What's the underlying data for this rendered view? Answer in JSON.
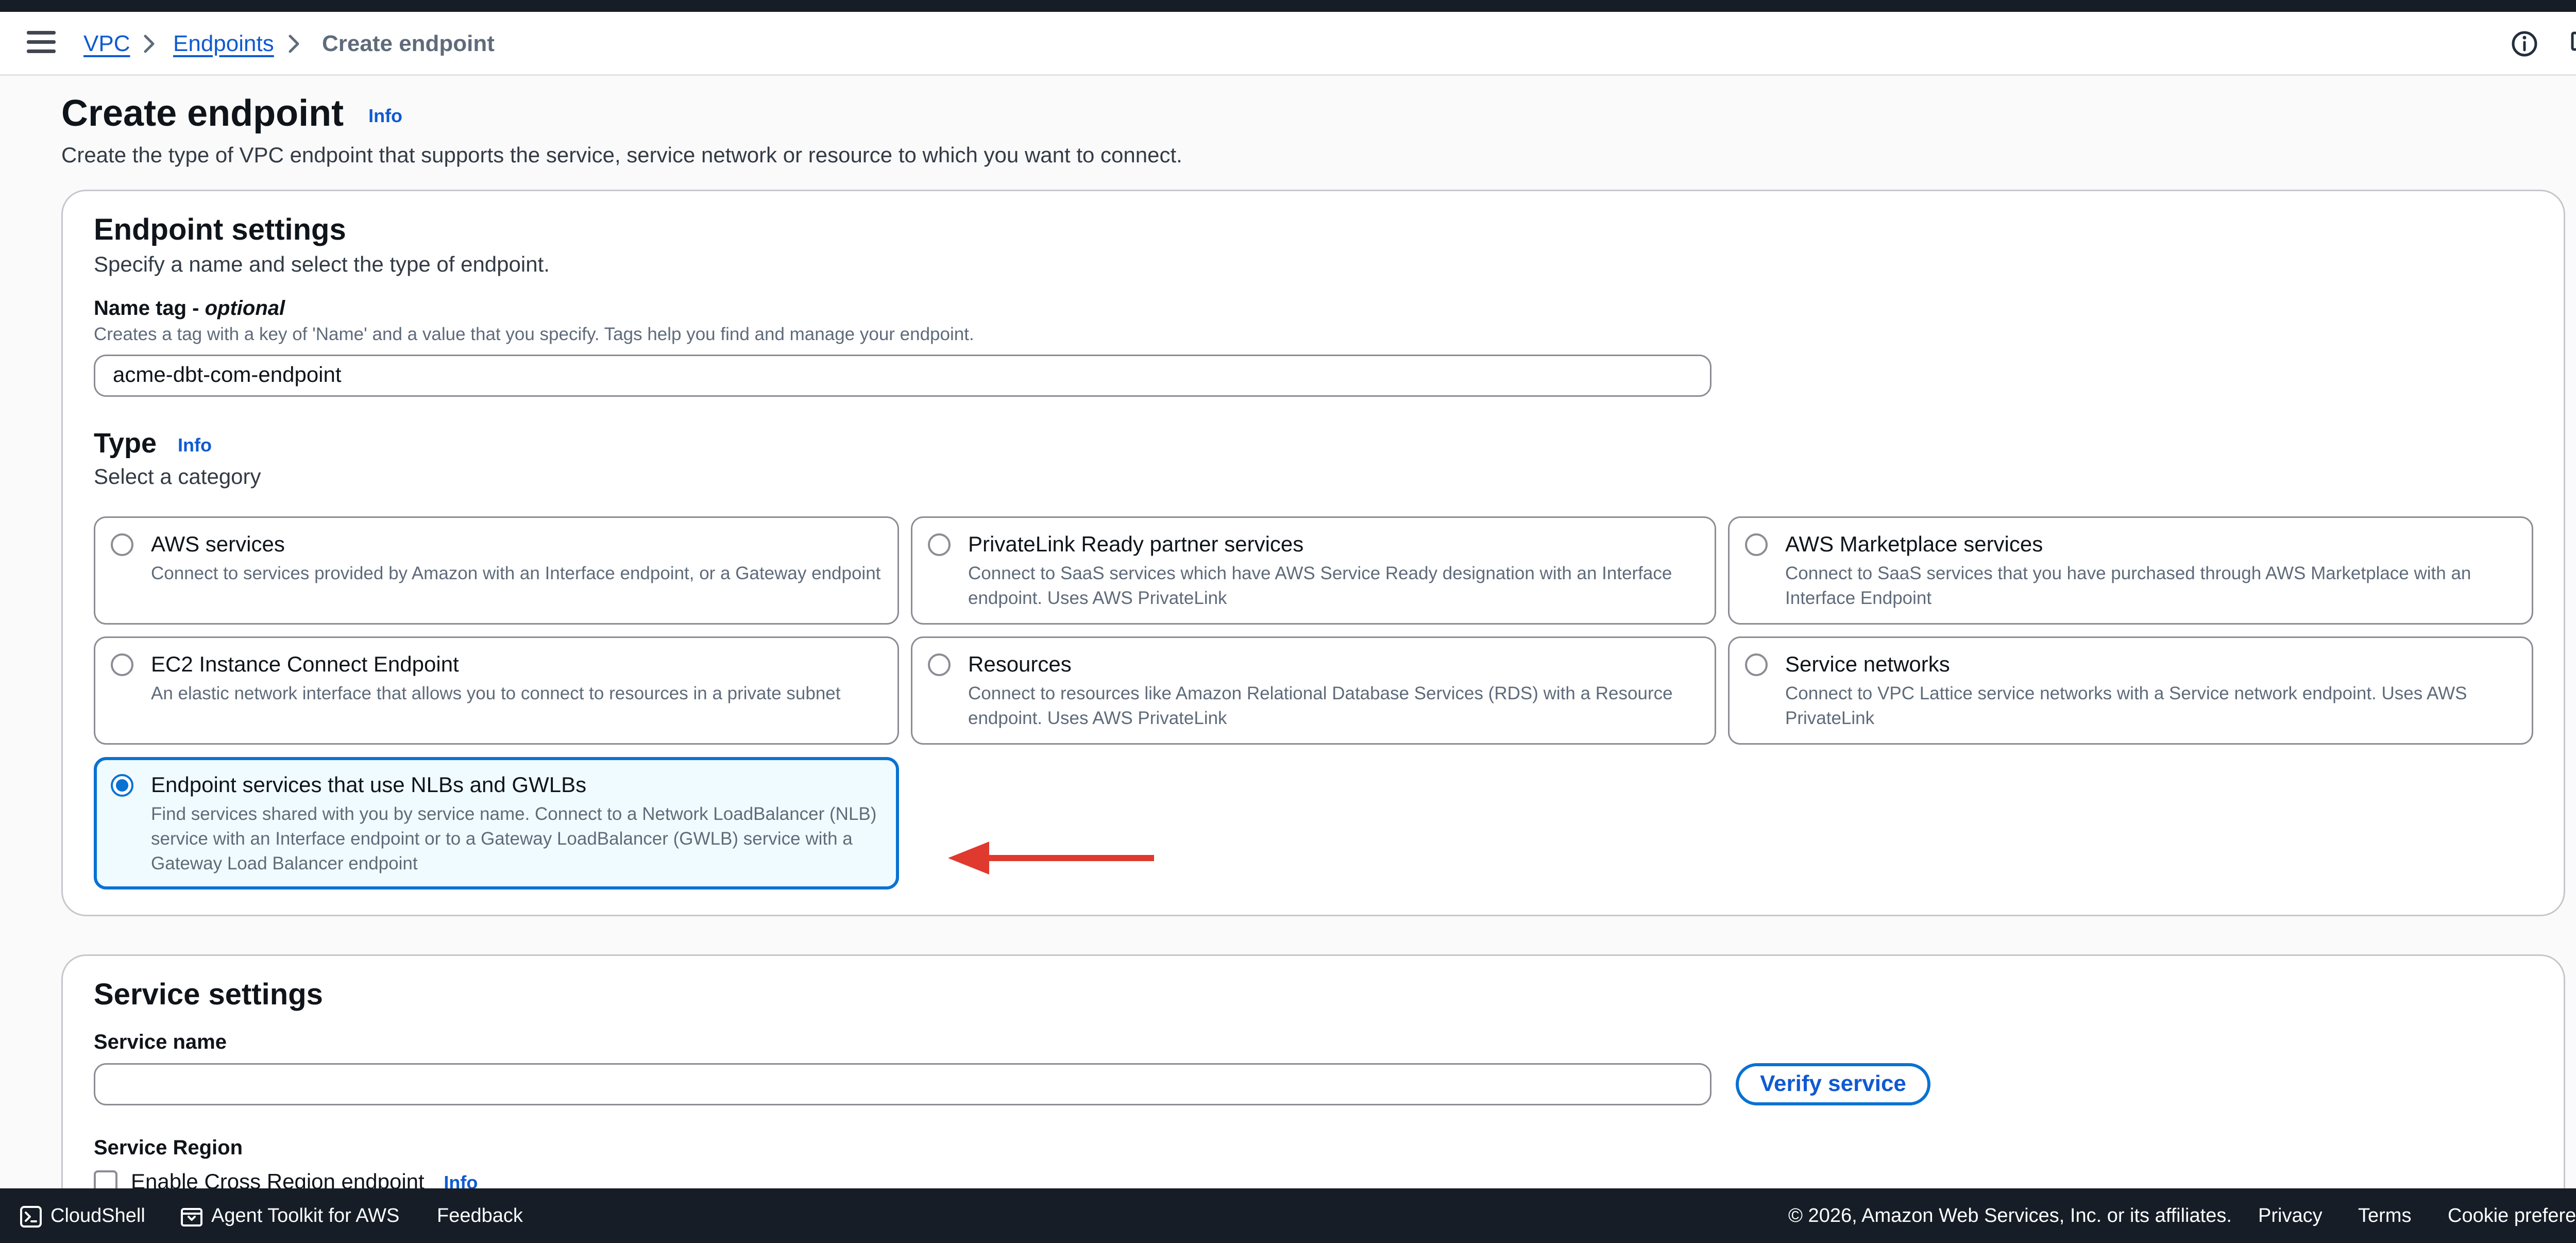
{
  "breadcrumb": {
    "items": [
      "VPC",
      "Endpoints"
    ],
    "current": "Create endpoint"
  },
  "page": {
    "title": "Create endpoint",
    "info": "Info",
    "description": "Create the type of VPC endpoint that supports the service, service network or resource to which you want to connect."
  },
  "endpoint_settings": {
    "title": "Endpoint settings",
    "description": "Specify a name and select the type of endpoint.",
    "name_tag": {
      "label": "Name tag - ",
      "optional": "optional",
      "hint": "Creates a tag with a key of 'Name' and a value that you specify. Tags help you find and manage your endpoint.",
      "value": "acme-dbt-com-endpoint"
    },
    "type": {
      "label": "Type",
      "info": "Info",
      "description": "Select a category",
      "options": [
        {
          "title": "AWS services",
          "description": "Connect to services provided by Amazon with an Interface endpoint, or a Gateway endpoint",
          "selected": false
        },
        {
          "title": "PrivateLink Ready partner services",
          "description": "Connect to SaaS services which have AWS Service Ready designation with an Interface endpoint. Uses AWS PrivateLink",
          "selected": false
        },
        {
          "title": "AWS Marketplace services",
          "description": "Connect to SaaS services that you have purchased through AWS Marketplace with an Interface Endpoint",
          "selected": false
        },
        {
          "title": "EC2 Instance Connect Endpoint",
          "description": "An elastic network interface that allows you to connect to resources in a private subnet",
          "selected": false
        },
        {
          "title": "Resources",
          "description": "Connect to resources like Amazon Relational Database Services (RDS) with a Resource endpoint. Uses AWS PrivateLink",
          "selected": false
        },
        {
          "title": "Service networks",
          "description": "Connect to VPC Lattice service networks with a Service network endpoint. Uses AWS PrivateLink",
          "selected": false
        },
        {
          "title": "Endpoint services that use NLBs and GWLBs",
          "description": "Find services shared with you by service name. Connect to a Network LoadBalancer (NLB) service with an Interface endpoint or to a Gateway LoadBalancer (GWLB) service with a Gateway Load Balancer endpoint",
          "selected": true
        }
      ]
    }
  },
  "service_settings": {
    "title": "Service settings",
    "service_name_label": "Service name",
    "service_name_value": "",
    "verify_button": "Verify service",
    "region_label": "Service Region",
    "cross_region_label": "Enable Cross Region endpoint",
    "cross_region_info": "Info"
  },
  "footer": {
    "cloudshell": "CloudShell",
    "agent_toolkit": "Agent Toolkit for AWS",
    "feedback": "Feedback",
    "copyright": "© 2026, Amazon Web Services, Inc. or its affiliates.",
    "privacy": "Privacy",
    "terms": "Terms",
    "cookies": "Cookie preferences"
  },
  "colors": {
    "accent": "#0972d3",
    "link": "#0f5ad1",
    "annotation_arrow": "#e0392d",
    "footer_bg": "#161d26"
  },
  "icons": [
    "menu-icon",
    "chevron-right-icon",
    "info-circle-icon",
    "feedback-icon",
    "cloudshell-icon",
    "agent-toolkit-icon"
  ]
}
